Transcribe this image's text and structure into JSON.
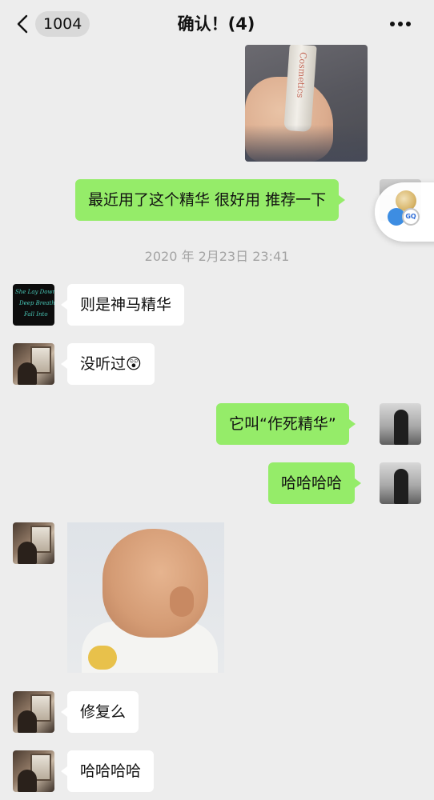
{
  "header": {
    "back_count": "1004",
    "title": "确认！(4)"
  },
  "photo": {
    "brand_text": "Cosmetics"
  },
  "messages": [
    {
      "side": "sent",
      "text": "最近用了这个精华 很好用 推荐一下"
    },
    {
      "side": "received",
      "text": "则是神马精华"
    },
    {
      "side": "received",
      "text": "没听过😲"
    },
    {
      "side": "sent",
      "text": "它叫“作死精华”"
    },
    {
      "side": "sent",
      "text": "哈哈哈哈"
    },
    {
      "side": "received",
      "type": "sticker"
    },
    {
      "side": "received",
      "text": "修复么"
    },
    {
      "side": "received",
      "text": "哈哈哈哈"
    }
  ],
  "timestamp": "2020 年 2月23日 23:41",
  "avatar_neon_text": [
    "She Lay Down",
    "Deep Breath",
    "Fall Into"
  ],
  "floating_widget": {
    "gq_label": "GQ"
  },
  "colors": {
    "background": "#ededed",
    "sent_bubble": "#95ec69",
    "received_bubble": "#ffffff",
    "timestamp_text": "#a3a3a3"
  },
  "icons": {
    "back": "chevron-left-icon",
    "more": "more-dots-icon"
  }
}
